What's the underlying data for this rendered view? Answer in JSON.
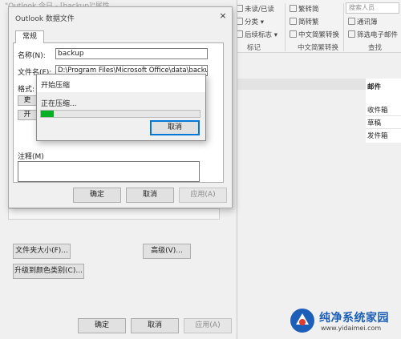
{
  "ribbon": {
    "unread_read": "未读/已读",
    "categorize": "分类",
    "followup": "后续标志",
    "trad_to_simp": "繁转简",
    "simp_to_trad": "简转繁",
    "chinese_convert": "中文简繁转换",
    "group_tags": "标记",
    "group_chinese": "中文简繁转换",
    "group_find": "查找",
    "search_people_placeholder": "搜索人员",
    "address_book": "通讯簿",
    "filter_email": "筛选电子邮件"
  },
  "right_panel": {
    "header": "邮件",
    "folders": [
      "收件箱",
      "草稿",
      "发件箱"
    ]
  },
  "bg_dialog": {
    "title": "\"Outlook 今日 - [backup]\"属性",
    "folder_size_button": "文件夹大小(F)...",
    "advanced_button": "高级(V)...",
    "upgrade_button": "升级到颜色类别(C)...",
    "ok_button": "确定",
    "cancel_button": "取消",
    "apply_button": "应用(A)"
  },
  "datafile_dialog": {
    "title": "Outlook 数据文件",
    "close": "×",
    "tab_general": "常规",
    "name_label": "名称(N):",
    "name_value": "backup",
    "filename_label": "文件名(F):",
    "filename_value": "D:\\Program Files\\Microsoft Office\\data\\backup",
    "format_label": "格式:",
    "hidden_button_1": "更",
    "hidden_button_2": "开",
    "comment_label": "注释(M)",
    "ok_button": "确定",
    "cancel_button": "取消",
    "apply_button": "应用(A)"
  },
  "compact_dialog": {
    "title": "开始压缩",
    "status": "正在压缩...",
    "progress": 0.08,
    "progress_color": "#06b025",
    "cancel_button": "取消"
  },
  "watermark": {
    "text": "纯净系统家园",
    "url": "www.yidaimei.com"
  }
}
